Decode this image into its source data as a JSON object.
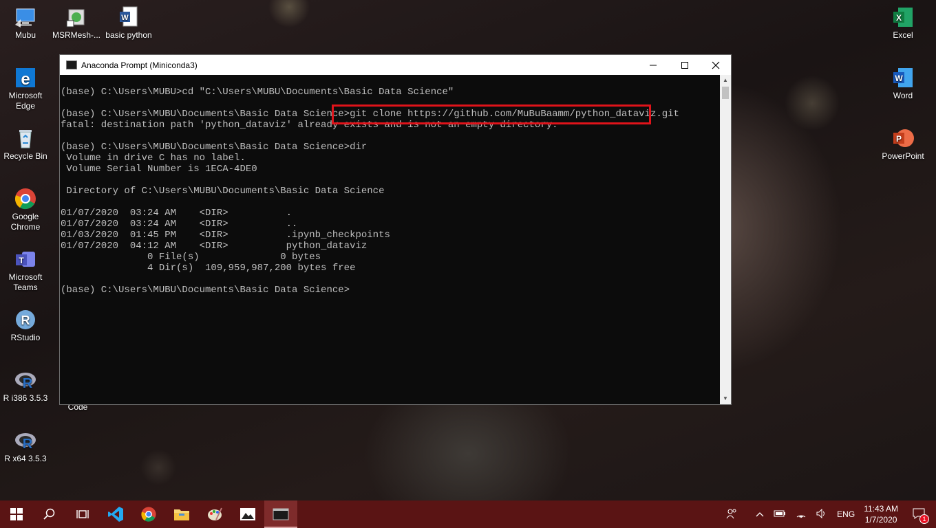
{
  "desktop": {
    "icons_left": [
      {
        "label": "Mubu"
      },
      {
        "label": "MSRMesh-..."
      },
      {
        "label": "basic python"
      },
      {
        "label": "Microsoft Edge"
      },
      {
        "label": "Recycle Bin"
      },
      {
        "label": "Google Chrome"
      },
      {
        "label": "Microsoft Teams"
      },
      {
        "label": "RStudio"
      },
      {
        "label": "R i386 3.5.3"
      },
      {
        "label": "R x64 3.5.3"
      },
      {
        "label": "Code"
      }
    ],
    "icons_right": [
      {
        "label": "Excel"
      },
      {
        "label": "Word"
      },
      {
        "label": "PowerPoint"
      }
    ]
  },
  "window": {
    "title": "Anaconda Prompt (Miniconda3)",
    "console_lines": [
      "(base) C:\\Users\\MUBU>cd \"C:\\Users\\MUBU\\Documents\\Basic Data Science\"",
      "",
      "(base) C:\\Users\\MUBU\\Documents\\Basic Data Science>git clone https://github.com/MuBuBaamm/python_dataviz.git",
      "fatal: destination path 'python_dataviz' already exists and is not an empty directory.",
      "",
      "(base) C:\\Users\\MUBU\\Documents\\Basic Data Science>dir",
      " Volume in drive C has no label.",
      " Volume Serial Number is 1ECA-4DE0",
      "",
      " Directory of C:\\Users\\MUBU\\Documents\\Basic Data Science",
      "",
      "01/07/2020  03:24 AM    <DIR>          .",
      "01/07/2020  03:24 AM    <DIR>          ..",
      "01/03/2020  01:45 PM    <DIR>          .ipynb_checkpoints",
      "01/07/2020  04:12 AM    <DIR>          python_dataviz",
      "               0 File(s)              0 bytes",
      "               4 Dir(s)  109,959,987,200 bytes free",
      "",
      "(base) C:\\Users\\MUBU\\Documents\\Basic Data Science>"
    ]
  },
  "taskbar": {
    "language": "ENG",
    "time": "11:43 AM",
    "date": "1/7/2020",
    "notification_count": "1"
  },
  "colors": {
    "taskbar": "#5a1414",
    "highlight": "#e0131a",
    "console_text": "#c0c0c0"
  }
}
